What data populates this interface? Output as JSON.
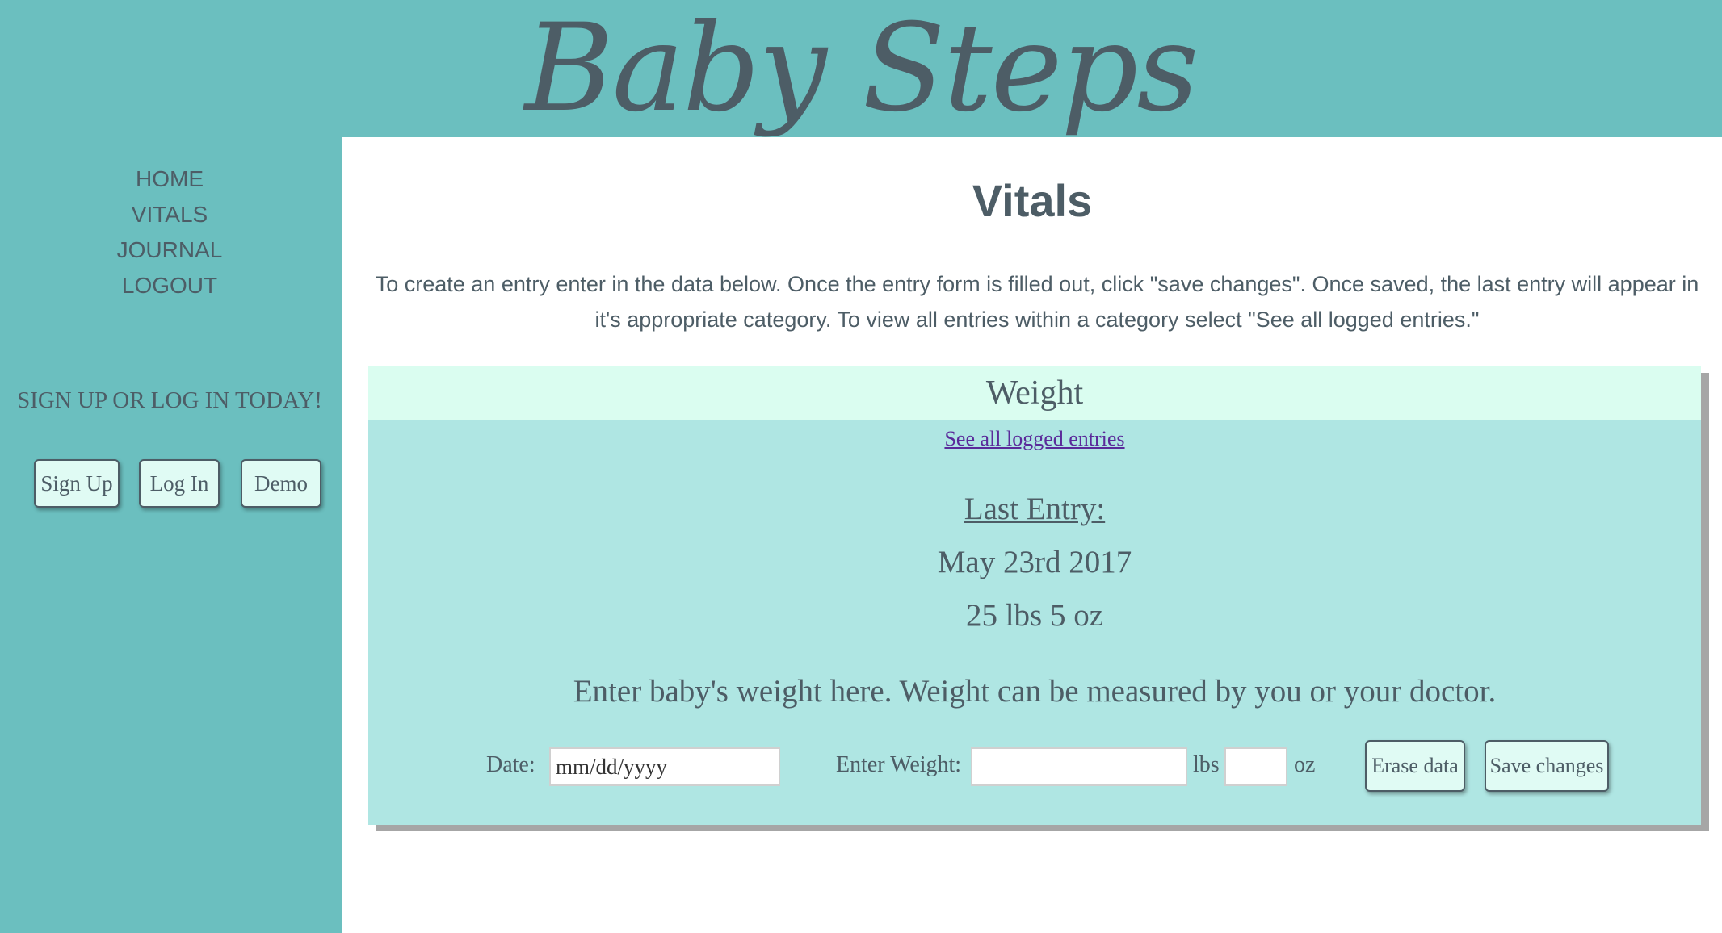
{
  "header": {
    "brand": "Baby Steps"
  },
  "sidebar": {
    "nav": [
      {
        "label": "HOME"
      },
      {
        "label": "VITALS"
      },
      {
        "label": "JOURNAL"
      },
      {
        "label": "LOGOUT"
      }
    ],
    "promo": "SIGN UP OR LOG IN TODAY!",
    "buttons": {
      "signup": "Sign Up",
      "login": "Log In",
      "demo": "Demo"
    }
  },
  "main": {
    "title": "Vitals",
    "instructions": "To create an entry enter in the data below. Once the entry form is filled out, click \"save changes\". Once saved, the last entry will appear in it's appropriate category. To view all entries within a category select \"See all logged entries.\"",
    "weight_card": {
      "header": "Weight",
      "see_all": "See all logged entries",
      "last_entry_label": "Last Entry:",
      "last_entry_date": "May 23rd 2017",
      "last_entry_value": "25 lbs 5 oz",
      "prompt": "Enter baby's weight here. Weight can be measured by you or your doctor.",
      "form": {
        "date_label": "Date:",
        "date_placeholder": "mm/dd/yyyy",
        "date_value": "",
        "weight_label": "Enter Weight:",
        "lbs_value": "",
        "lbs_unit": "lbs",
        "oz_value": "",
        "oz_unit": "oz",
        "erase_label": "Erase data",
        "save_label": "Save changes"
      }
    }
  },
  "colors": {
    "sidebar_bg": "#6bbfbf",
    "card_bg": "#afe6e3",
    "card_header_bg": "#dafdf0",
    "button_bg": "#e0fbf4",
    "text": "#4d5d66",
    "link": "#5a2a9a"
  }
}
